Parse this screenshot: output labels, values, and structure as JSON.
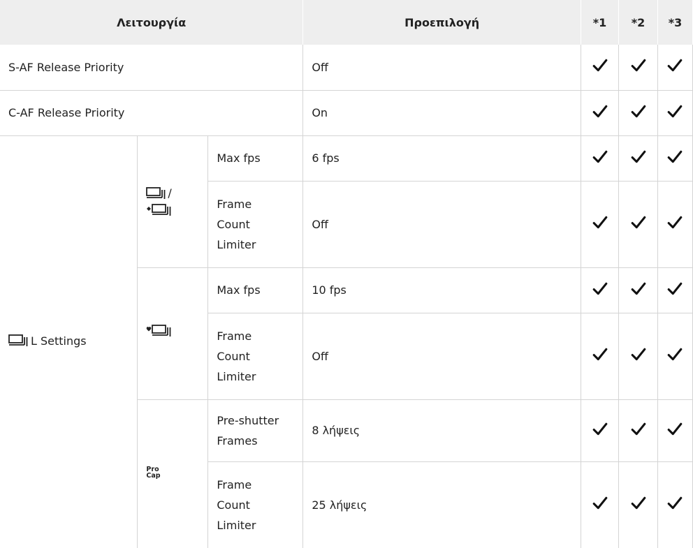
{
  "header": {
    "function": "Λειτουργία",
    "default": "Προεπιλογή",
    "c1": "*1",
    "c2": "*2",
    "c3": "*3"
  },
  "rows": {
    "s_af": {
      "label": "S-AF Release Priority",
      "value": "Off"
    },
    "c_af": {
      "label": "C-AF Release Priority",
      "value": "On"
    }
  },
  "lsettings": {
    "label": "L Settings",
    "icon": "sequential-shooting-icon",
    "groups": {
      "seq": {
        "icon": "sequential-and-silent-sequential-icon",
        "separator": "/",
        "max_fps": {
          "label": "Max fps",
          "value": "6 fps"
        },
        "limiter": {
          "line1": "Frame",
          "line2": "Count",
          "line3": "Limiter",
          "value": "Off"
        }
      },
      "silent": {
        "icon": "silent-sequential-icon",
        "max_fps": {
          "label": "Max fps",
          "value": "10 fps"
        },
        "limiter": {
          "line1": "Frame",
          "line2": "Count",
          "line3": "Limiter",
          "value": "Off"
        }
      },
      "procap": {
        "icon_line1": "Pro",
        "icon_line2": "Cap",
        "pre_shutter": {
          "line1": "Pre-shutter",
          "line2": "Frames",
          "value": "8 λήψεις"
        },
        "limiter": {
          "line1": "Frame",
          "line2": "Count",
          "line3": "Limiter",
          "value": "25 λήψεις"
        }
      }
    }
  },
  "check_icon": "checkmark-icon"
}
